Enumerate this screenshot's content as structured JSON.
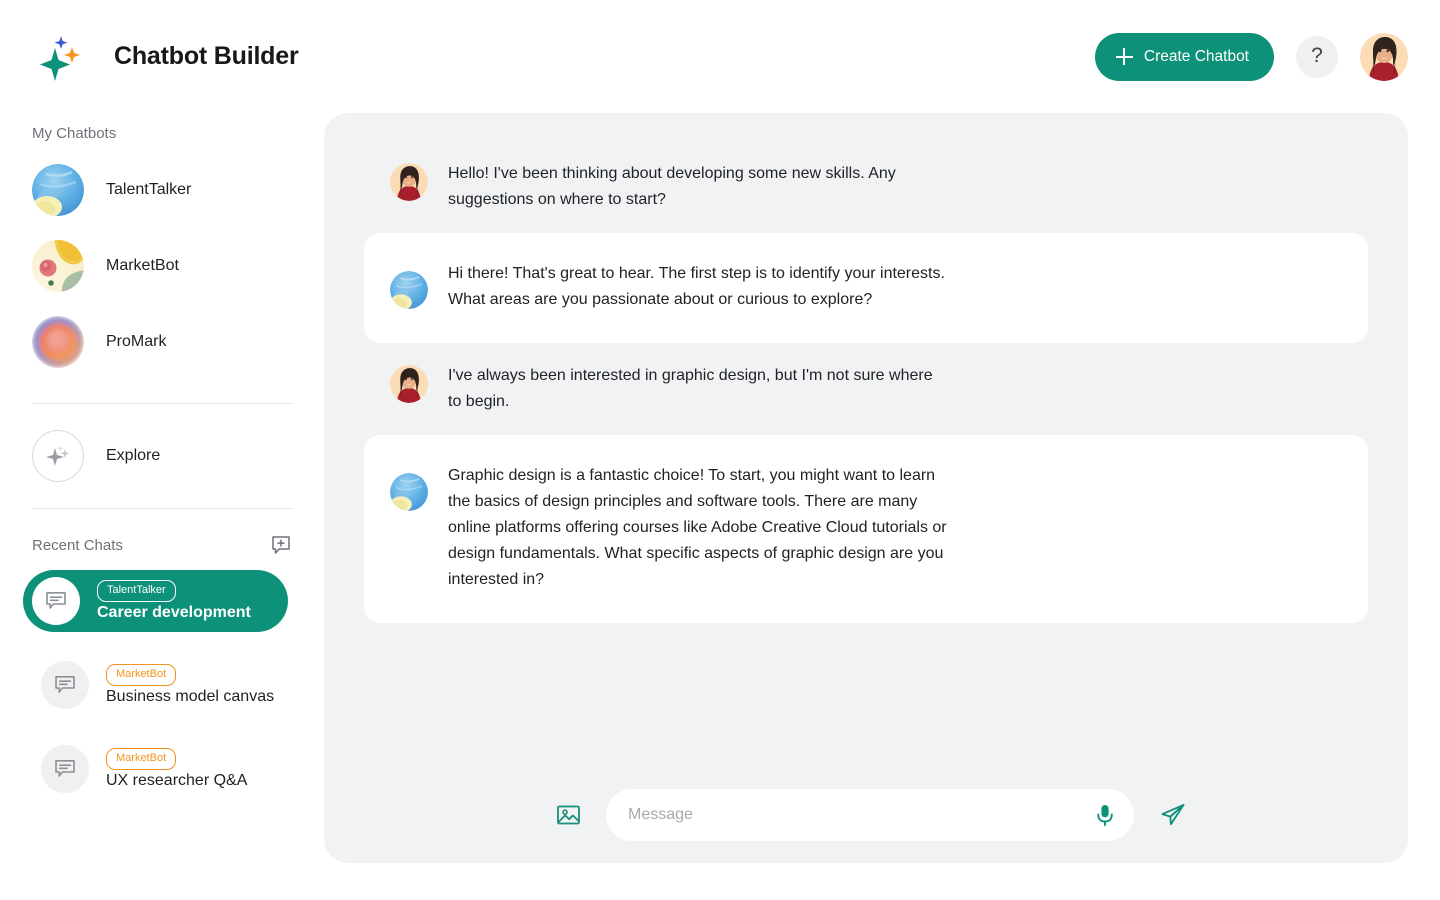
{
  "header": {
    "brand_title": "Chatbot Builder",
    "logo_icon": "sparkle-logo-icon",
    "create_button_label": "Create Chatbot",
    "create_button_icon": "plus-icon",
    "help_button_label": "?",
    "help_button_icon": "question-mark-icon",
    "avatar_icon": "user-avatar",
    "accent_color": "#0d9178"
  },
  "sidebar": {
    "my_chatbots_label": "My Chatbots",
    "bots": [
      {
        "name": "TalentTalker",
        "avatar_icon": "talenttalker-avatar"
      },
      {
        "name": "MarketBot",
        "avatar_icon": "marketbot-avatar"
      },
      {
        "name": "ProMark",
        "avatar_icon": "promark-avatar"
      }
    ],
    "explore": {
      "label": "Explore",
      "icon": "sparkle-icon"
    },
    "recent_chats_label": "Recent Chats",
    "new_chat_icon": "new-chat-icon",
    "chats": [
      {
        "badge": "TalentTalker",
        "title": "Career development",
        "icon": "chat-bubble-icon",
        "active": true,
        "badge_color": "#ffffff"
      },
      {
        "badge": "MarketBot",
        "title": "Business model canvas",
        "icon": "chat-bubble-icon",
        "active": false,
        "badge_color": "#f0941f"
      },
      {
        "badge": "MarketBot",
        "title": "UX researcher Q&A",
        "icon": "chat-bubble-icon",
        "active": false,
        "badge_color": "#f0941f"
      }
    ]
  },
  "conversation": {
    "messages": [
      {
        "sender": "user",
        "avatar_icon": "user-avatar",
        "text": "Hello! I've been thinking about developing some new skills. Any suggestions on where to start?"
      },
      {
        "sender": "bot",
        "avatar_icon": "talenttalker-avatar",
        "text": "Hi there! That's great to hear. The first step is to identify your interests. What areas are you passionate about or curious to explore?"
      },
      {
        "sender": "user",
        "avatar_icon": "user-avatar",
        "text": "I've always been interested in graphic design, but I'm not sure where to begin."
      },
      {
        "sender": "bot",
        "avatar_icon": "talenttalker-avatar",
        "text": "Graphic design is a fantastic choice! To start, you might want to learn the basics of design principles and software tools. There are many online platforms offering courses like Adobe Creative Cloud tutorials or design fundamentals. What specific aspects of graphic design are you interested in?"
      }
    ]
  },
  "composer": {
    "image_icon": "image-upload-icon",
    "placeholder": "Message",
    "value": "",
    "mic_icon": "microphone-icon",
    "send_icon": "send-paper-plane-icon"
  }
}
